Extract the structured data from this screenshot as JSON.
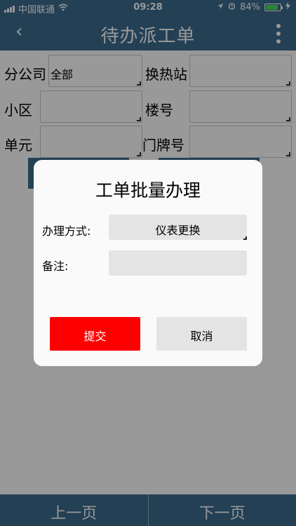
{
  "statusbar": {
    "carrier": "中国联通",
    "time": "09:28",
    "battery": "84%",
    "battery_level": 0.84
  },
  "navbar": {
    "back_icon": "‹",
    "title": "待办派工单"
  },
  "filters": {
    "branch_label": "分公司",
    "branch_value": "全部",
    "station_label": "换热站",
    "station_value": "",
    "community_label": "小区",
    "community_value": "",
    "building_label": "楼号",
    "building_value": "",
    "unit_label": "单元",
    "unit_value": "",
    "door_label": "门牌号",
    "door_value": ""
  },
  "dialog": {
    "title": "工单批量办理",
    "method_label": "办理方式:",
    "method_value": "仪表更换",
    "remark_label": "备注:",
    "remark_value": "",
    "submit_label": "提交",
    "cancel_label": "取消"
  },
  "bottombar": {
    "prev_label": "上一页",
    "next_label": "下一页"
  },
  "colors": {
    "primary": "#3b6b8e",
    "danger": "#ff0000",
    "overlay": "rgba(0,0,0,0.40)"
  }
}
